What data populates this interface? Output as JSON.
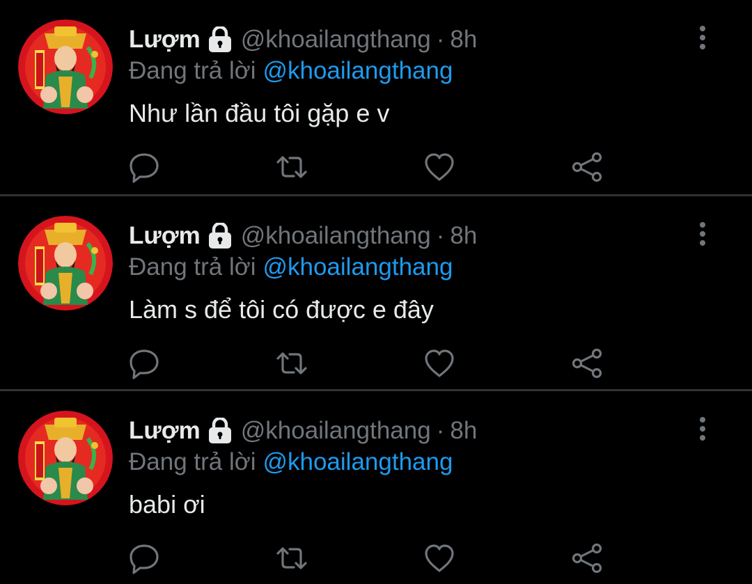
{
  "colors": {
    "background": "#000000",
    "primary_text": "#e7e9ea",
    "secondary_text": "#71767b",
    "link": "#1d9bf0",
    "divider": "#2f3336"
  },
  "icons": {
    "protected": "lock-icon",
    "more": "more-vertical-icon",
    "reply": "comment-icon",
    "retweet": "retweet-icon",
    "like": "heart-icon",
    "share": "share-icon"
  },
  "tweets": [
    {
      "author_name": "Lượm",
      "author_handle": "@khoailangthang",
      "separator": "·",
      "time": "8h",
      "replying_prefix": "Đang trả lời",
      "replying_to": "@khoailangthang",
      "text": "Như lần đầu tôi gặp e v"
    },
    {
      "author_name": "Lượm",
      "author_handle": "@khoailangthang",
      "separator": "·",
      "time": "8h",
      "replying_prefix": "Đang trả lời",
      "replying_to": "@khoailangthang",
      "text": "Làm s để tôi có được e đây"
    },
    {
      "author_name": "Lượm",
      "author_handle": "@khoailangthang",
      "separator": "·",
      "time": "8h",
      "replying_prefix": "Đang trả lời",
      "replying_to": "@khoailangthang",
      "text": "babi ơi"
    }
  ]
}
